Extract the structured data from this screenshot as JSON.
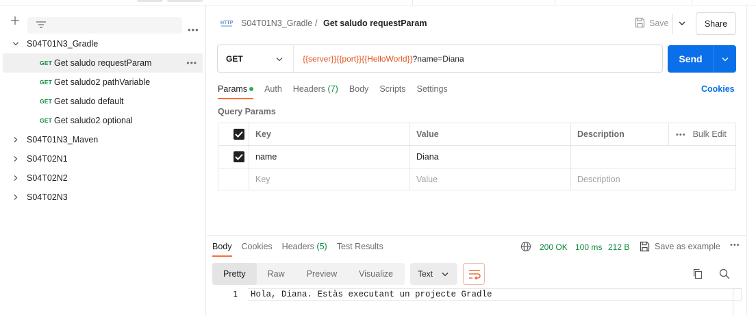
{
  "sidebar": {
    "collections": [
      {
        "label": "S04T01N3_Gradle",
        "expanded": true
      },
      {
        "label": "S04T01N3_Maven",
        "expanded": false
      },
      {
        "label": "S04T02N1",
        "expanded": false
      },
      {
        "label": "S04T02N2",
        "expanded": false
      },
      {
        "label": "S04T02N3",
        "expanded": false
      }
    ],
    "requests": [
      {
        "method": "GET",
        "label": "Get saludo requestParam",
        "selected": true
      },
      {
        "method": "GET",
        "label": "Get saludo2 pathVariable"
      },
      {
        "method": "GET",
        "label": "Get saludo default"
      },
      {
        "method": "GET",
        "label": "Get saludo2 optional"
      }
    ],
    "more": "•••"
  },
  "header": {
    "breadcrumb_parent": "S04T01N3_Gradle",
    "separator": "/",
    "title": "Get saludo requestParam",
    "save_label": "Save",
    "share_label": "Share"
  },
  "request": {
    "method": "GET",
    "url_vars": [
      "{{server}}",
      "{{port}}",
      "{{HelloWorld}}"
    ],
    "url_query": "?name=Diana",
    "send_label": "Send"
  },
  "request_tabs": [
    {
      "label": "Params",
      "active": true,
      "dot": true
    },
    {
      "label": "Auth"
    },
    {
      "label": "Headers",
      "count": "(7)"
    },
    {
      "label": "Body"
    },
    {
      "label": "Scripts"
    },
    {
      "label": "Settings"
    }
  ],
  "cookies_label": "Cookies",
  "query_params": {
    "title": "Query Params",
    "headers": {
      "key": "Key",
      "value": "Value",
      "description": "Description",
      "bulk_more": "•••",
      "bulk_edit": "Bulk Edit"
    },
    "rows": [
      {
        "checked": true,
        "key": "name",
        "value": "Diana",
        "description": ""
      }
    ],
    "placeholder": {
      "key": "Key",
      "value": "Value",
      "description": "Description"
    }
  },
  "response": {
    "tabs": [
      {
        "label": "Body",
        "active": true
      },
      {
        "label": "Cookies"
      },
      {
        "label": "Headers",
        "count": "(5)"
      },
      {
        "label": "Test Results"
      }
    ],
    "status": "200 OK",
    "time": "100 ms",
    "size": "212 B",
    "save_example": "Save as example",
    "more": "•••",
    "views": [
      {
        "label": "Pretty",
        "active": true
      },
      {
        "label": "Raw"
      },
      {
        "label": "Preview"
      },
      {
        "label": "Visualize"
      }
    ],
    "format": "Text",
    "line_number": "1",
    "body_text": "Hola, Diana. Estàs executant un projecte Gradle"
  },
  "colors": {
    "accent": "#ff6c37",
    "send": "#0a6fe8",
    "status_ok": "#0b8a3d",
    "variable": "#e2571f"
  }
}
